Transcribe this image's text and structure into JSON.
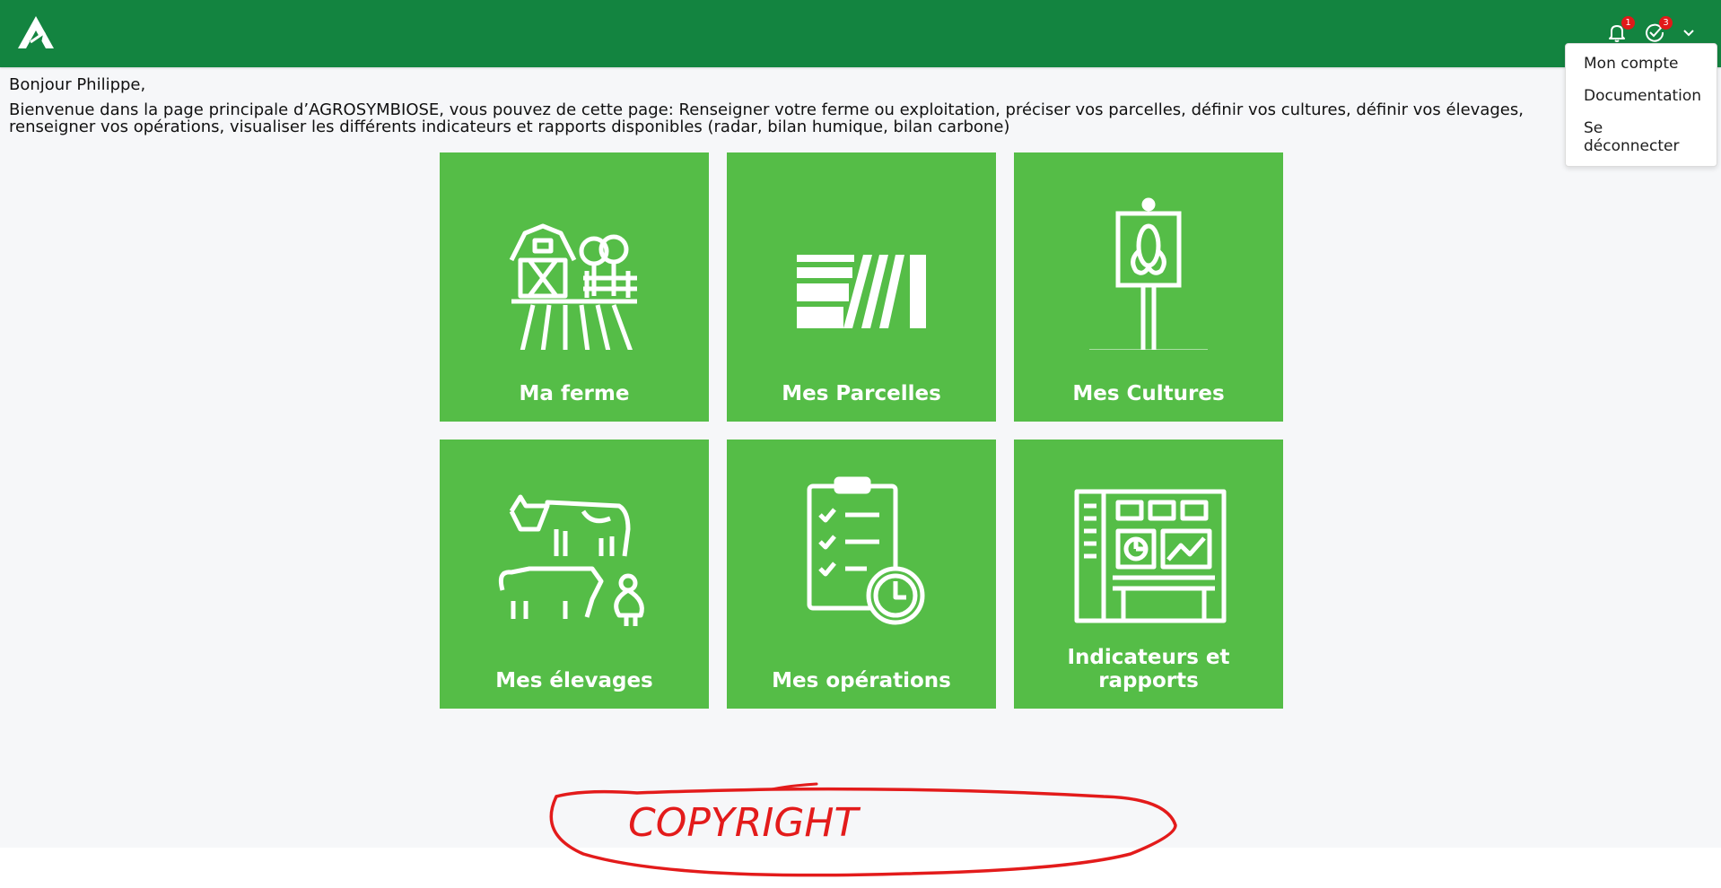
{
  "header": {
    "notifications_badge": "1",
    "tasks_badge": "3"
  },
  "menu": {
    "items": [
      "Mon compte",
      "Documentation",
      "Se déconnecter"
    ]
  },
  "main": {
    "greeting": "Bonjour Philippe,",
    "intro": "Bienvenue dans la page principale d’AGROSYMBIOSE, vous pouvez de cette page: Renseigner votre ferme ou exploitation, préciser vos parcelles, définir vos cultures, définir vos élevages, renseigner vos opérations, visualiser les différents indicateurs et rapports disponibles (radar, bilan humique, bilan carbone)",
    "tiles": [
      {
        "label": "Ma ferme",
        "icon": "farm-icon"
      },
      {
        "label": "Mes Parcelles",
        "icon": "parcels-icon"
      },
      {
        "label": "Mes Cultures",
        "icon": "crop-sign-icon"
      },
      {
        "label": "Mes élevages",
        "icon": "livestock-icon"
      },
      {
        "label": "Mes opérations",
        "icon": "checklist-clock-icon"
      },
      {
        "label": "Indicateurs et rapports",
        "icon": "dashboard-icon"
      }
    ]
  },
  "overlay": {
    "handwritten": "COPYRIGHT"
  },
  "colors": {
    "header": "#138440",
    "tile": "#55bd47",
    "badge": "#e11919",
    "annotation": "#e31b1b"
  }
}
